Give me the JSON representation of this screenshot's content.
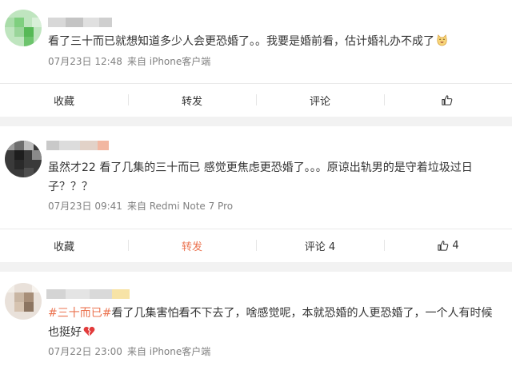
{
  "comments": [
    {
      "text": "看了三十而已就想知道多少人会更恐婚了。。我要是婚前看，估计婚礼办不成了",
      "emoji_icon": "laughing-cat-face-icon",
      "time": "07月23日 12:48",
      "source": "来自 iPhone客户端",
      "actions": {
        "favorite": "收藏",
        "repost": "转发",
        "comment": "评论",
        "like_count": ""
      }
    },
    {
      "text": "虽然才22 看了几集的三十而已 感觉更焦虑更恐婚了。。。原谅出轨男的是守着垃圾过日子？？？",
      "time": "07月23日 09:41",
      "source": "来自 Redmi Note 7 Pro",
      "actions": {
        "favorite": "收藏",
        "repost": "转发",
        "comment": "评论 4",
        "like_count": "4"
      }
    },
    {
      "topic": "#三十而已#",
      "text": "看了几集害怕看不下去了，啥感觉呢，本就恐婚的人更恐婚了，一个人有时候也挺好",
      "emoji_icon": "broken-heart-icon",
      "time": "07月22日 23:00",
      "source": "来自 iPhone客户端"
    }
  ],
  "colors": {
    "accent": "#eb7350",
    "meta_text": "#808080",
    "background": "#f2f2f2"
  }
}
